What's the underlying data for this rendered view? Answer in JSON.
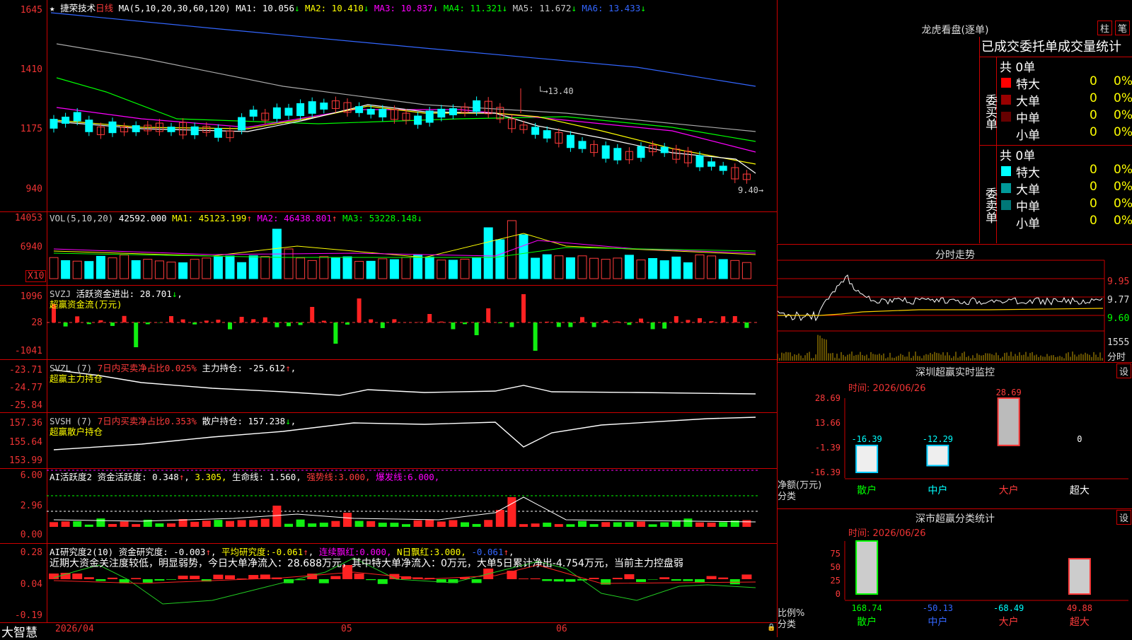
{
  "stock": {
    "name": "捷荣技术",
    "period": "日线"
  },
  "ma": {
    "params": "MA(5,10,20,30,60,120)",
    "items": [
      {
        "label": "MA1:",
        "value": "10.056",
        "arrow": "↓",
        "color": "#ffffff"
      },
      {
        "label": "MA2:",
        "value": "10.410",
        "arrow": "↓",
        "color": "#ffff00"
      },
      {
        "label": "MA3:",
        "value": "10.837",
        "arrow": "↓",
        "color": "#ff00ff"
      },
      {
        "label": "MA4:",
        "value": "11.321",
        "arrow": "↓",
        "color": "#00ff00"
      },
      {
        "label": "MA5:",
        "value": "11.672",
        "arrow": "↓",
        "color": "#cccccc"
      },
      {
        "label": "MA6:",
        "value": "13.433",
        "arrow": "↓",
        "color": "#3366ff"
      }
    ],
    "high_label": "13.40",
    "low_label": "9.40"
  },
  "price_axis": [
    "1645",
    "1410",
    "1175",
    "940"
  ],
  "vol": {
    "label": "VOL(5,10,20)",
    "value": "42592.000",
    "items": [
      {
        "label": "MA1:",
        "value": "45123.199",
        "arrow": "↑",
        "color": "#ffff00"
      },
      {
        "label": "MA2:",
        "value": "46438.801",
        "arrow": "↑",
        "color": "#ff00ff"
      },
      {
        "label": "MA3:",
        "value": "53228.148",
        "arrow": "↓",
        "color": "#00ff00"
      }
    ],
    "axis": [
      "14053",
      "6940"
    ],
    "unit": "X10"
  },
  "svzj": {
    "label": "SVZJ",
    "desc": "活跃资金进出:",
    "value": "28.701",
    "arrow": "↓",
    "sub": "超赢资金流(万元)",
    "axis": [
      "1096",
      "28",
      "-1041"
    ]
  },
  "svzl": {
    "label": "SVZL (7)",
    "desc": "7日内买卖净占比0.025%",
    "item": "主力持仓:",
    "value": "-25.612",
    "arrow": "↑",
    "sub": "超赢主力持仓",
    "axis": [
      "-23.71",
      "-24.77",
      "-25.84"
    ]
  },
  "svsh": {
    "label": "SVSH (7)",
    "desc": "7日内买卖净占比0.353%",
    "item": "散户持仓:",
    "value": "157.238",
    "arrow": "↓",
    "sub": "超赢散户持仓",
    "axis": [
      "157.36",
      "155.64",
      "153.99"
    ]
  },
  "ai1": {
    "label": "AI活跃度2",
    "item": "资金活跃度:",
    "value": "0.348",
    "value2": "3.305",
    "life_label": "生命线:",
    "life": "1.560",
    "strong_label": "强势线:",
    "strong": "3.000",
    "burst_label": "爆发线:",
    "burst": "6.000",
    "axis": [
      "6.00",
      "2.96",
      "0.00"
    ]
  },
  "ai2": {
    "label": "AI研究度2(10)",
    "item": "资金研究度:",
    "value": "-0.003",
    "avg_label": "平均研究度:",
    "avg": "-0.061",
    "cont_label": "连续飘红:",
    "cont": "0.000",
    "n_label": "N日飘红:",
    "n": "3.000",
    "last": "-0.061",
    "comment": "近期大资金关注度较低，明显弱势，今日大单净流入：28.688万元，其中特大单净流入：0万元，大单5日累计净出-4.754万元，当前主力控盘弱",
    "axis": [
      "0.28",
      "0.04",
      "-0.19"
    ]
  },
  "bottom": {
    "brand": "大智慧",
    "dates": [
      "2026/04",
      "05",
      "06"
    ]
  },
  "longhu": {
    "title": "龙虎看盘(逐单)",
    "tab_bar": "柱",
    "tab_order": "笔",
    "subtitle": "已成交委托单成交量统计",
    "buy_side": "委买单",
    "sell_side": "委卖单",
    "buy_total": "共 0单",
    "sell_total": "共 0单",
    "buy_rows": [
      {
        "name": "特大",
        "vol": "0",
        "pct": "0%",
        "color": "#ff0000"
      },
      {
        "name": "大单",
        "vol": "0",
        "pct": "0%",
        "color": "#990000"
      },
      {
        "name": "中单",
        "vol": "0",
        "pct": "0%",
        "color": "#660000"
      },
      {
        "name": "小单",
        "vol": "0",
        "pct": "0%",
        "color": ""
      }
    ],
    "sell_rows": [
      {
        "name": "特大",
        "vol": "0",
        "pct": "0%",
        "color": "#00ffff"
      },
      {
        "name": "大单",
        "vol": "0",
        "pct": "0%",
        "color": "#009999"
      },
      {
        "name": "中单",
        "vol": "0",
        "pct": "0%",
        "color": "#007777"
      },
      {
        "name": "小单",
        "vol": "0",
        "pct": "0%",
        "color": ""
      }
    ]
  },
  "intraday": {
    "title": "分时走势",
    "axis": [
      "9.95",
      "9.77",
      "9.60"
    ],
    "vol_axis": "1555",
    "vol_unit": "分时"
  },
  "sz_monitor": {
    "title": "深圳超赢实时监控",
    "setting": "设",
    "time_label": "时间:",
    "time": "2026/06/26",
    "axis": [
      "28.69",
      "13.66",
      "-1.39",
      "-16.39"
    ],
    "y_caption": "净额(万元)",
    "x_caption": "分类",
    "categories": [
      "散户",
      "中户",
      "大户",
      "超大"
    ],
    "values": [
      "-16.39",
      "-12.29",
      "28.69",
      "0"
    ]
  },
  "sz_stats": {
    "title": "深市超赢分类统计",
    "setting": "设",
    "time_label": "时间:",
    "time": "2026/06/26",
    "axis": [
      "75",
      "50",
      "25",
      "0"
    ],
    "y_caption": "比例%",
    "x_caption": "分类",
    "categories": [
      "散户",
      "中户",
      "大户",
      "超大"
    ],
    "values": [
      "168.74",
      "-50.13",
      "-68.49",
      "49.88"
    ]
  },
  "chart_data": [
    {
      "type": "bar",
      "title": "深圳超赢实时监控",
      "ylabel": "净额(万元)",
      "xlabel": "分类",
      "categories": [
        "散户",
        "中户",
        "大户",
        "超大"
      ],
      "values": [
        -16.39,
        -12.29,
        28.69,
        0
      ],
      "ylim": [
        -16.39,
        28.69
      ]
    },
    {
      "type": "bar",
      "title": "深市超赢分类统计",
      "ylabel": "比例%",
      "xlabel": "分类",
      "categories": [
        "散户",
        "中户",
        "大户",
        "超大"
      ],
      "values": [
        168.74,
        -50.13,
        -68.49,
        49.88
      ],
      "ylim": [
        0,
        75
      ]
    }
  ]
}
